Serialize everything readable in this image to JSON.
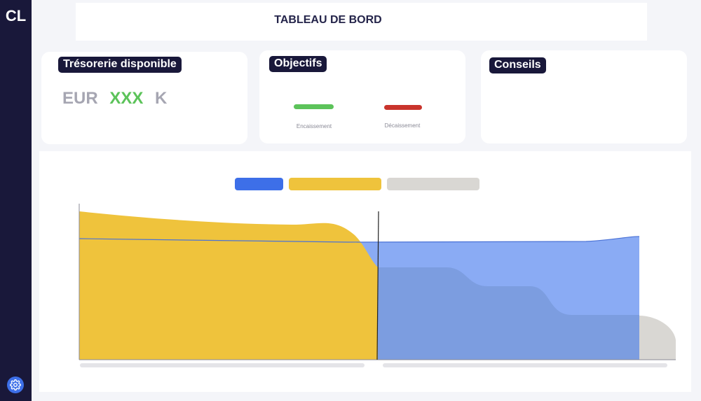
{
  "app": {
    "logo": "CL"
  },
  "header": {
    "title": "TABLEAU DE BORD"
  },
  "cards": {
    "tresorerie": {
      "title": "Trésorerie disponible",
      "currency": "EUR",
      "value": "XXX",
      "unit": "K",
      "currency_color": "#a6a6b2",
      "value_color": "#5cc35a"
    },
    "objectifs": {
      "title": "Objectifs",
      "items": [
        {
          "label": "Encaissement",
          "color": "#5cc35a"
        },
        {
          "label": "Décaissement",
          "color": "#c9342c"
        }
      ]
    },
    "conseils": {
      "title": "Conseils"
    }
  },
  "chart": {
    "legend_colors": [
      "#3d6fe8",
      "#efc33c",
      "#d9d7d3"
    ]
  },
  "colors": {
    "sidebar": "#19183a",
    "accent": "#3d6fe8",
    "yellow_area": "#efc33c",
    "blue_area": "#8aabf4",
    "blue_area_dark": "#7c9de0",
    "grey_area": "#d9d7d3"
  },
  "icons": {
    "settings": "gear-icon"
  }
}
